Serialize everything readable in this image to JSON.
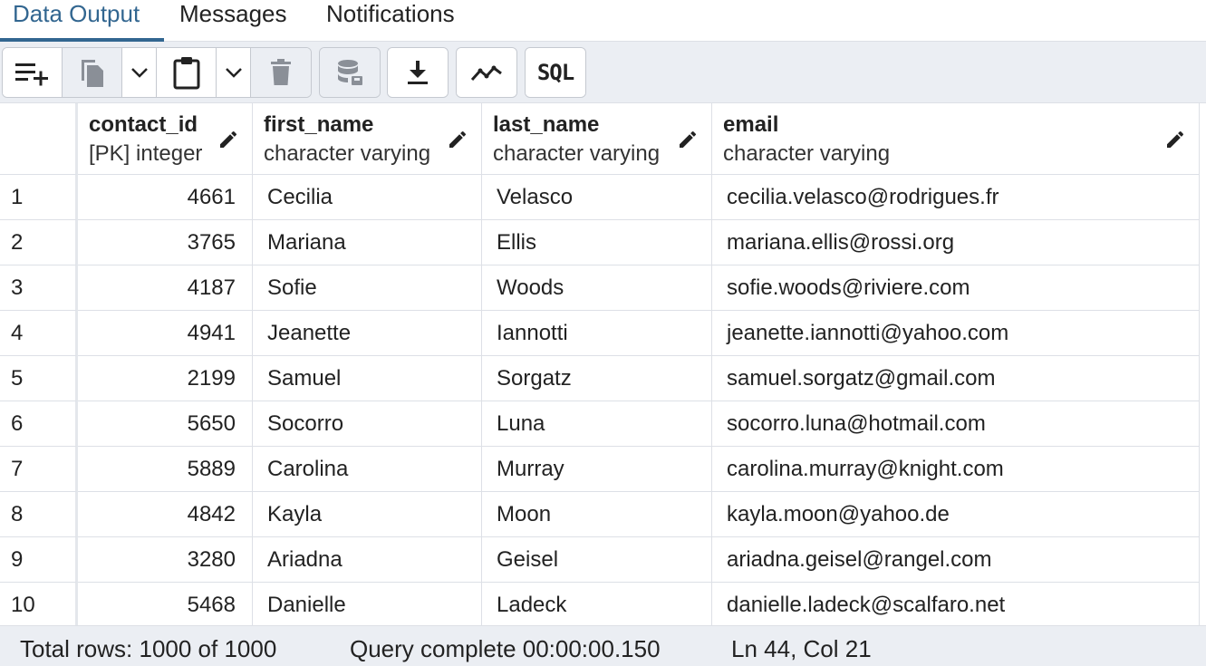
{
  "tabs": [
    {
      "label": "Data Output",
      "active": true
    },
    {
      "label": "Messages",
      "active": false
    },
    {
      "label": "Notifications",
      "active": false
    }
  ],
  "toolbar": {
    "buttons": [
      {
        "icon": "add-row-icon",
        "enabled": true
      },
      {
        "icon": "copy-icon",
        "enabled": false
      },
      {
        "icon": "chevron-down-icon",
        "enabled": true
      },
      {
        "icon": "paste-icon",
        "enabled": true
      },
      {
        "icon": "chevron-down-icon",
        "enabled": true
      },
      {
        "icon": "delete-icon",
        "enabled": false
      },
      {
        "icon": "save-data-icon",
        "enabled": false
      },
      {
        "icon": "download-icon",
        "enabled": true
      },
      {
        "icon": "graph-icon",
        "enabled": true
      },
      {
        "icon": "sql-icon",
        "enabled": true
      }
    ],
    "sql_label": "SQL"
  },
  "columns": [
    {
      "name": "contact_id",
      "type": "[PK] integer"
    },
    {
      "name": "first_name",
      "type": "character varying"
    },
    {
      "name": "last_name",
      "type": "character varying"
    },
    {
      "name": "email",
      "type": "character varying"
    }
  ],
  "rows": [
    {
      "n": "1",
      "contact_id": "4661",
      "first_name": "Cecilia",
      "last_name": "Velasco",
      "email": "cecilia.velasco@rodrigues.fr"
    },
    {
      "n": "2",
      "contact_id": "3765",
      "first_name": "Mariana",
      "last_name": "Ellis",
      "email": "mariana.ellis@rossi.org"
    },
    {
      "n": "3",
      "contact_id": "4187",
      "first_name": "Sofie",
      "last_name": "Woods",
      "email": "sofie.woods@riviere.com"
    },
    {
      "n": "4",
      "contact_id": "4941",
      "first_name": "Jeanette",
      "last_name": "Iannotti",
      "email": "jeanette.iannotti@yahoo.com"
    },
    {
      "n": "5",
      "contact_id": "2199",
      "first_name": "Samuel",
      "last_name": "Sorgatz",
      "email": "samuel.sorgatz@gmail.com"
    },
    {
      "n": "6",
      "contact_id": "5650",
      "first_name": "Socorro",
      "last_name": "Luna",
      "email": "socorro.luna@hotmail.com"
    },
    {
      "n": "7",
      "contact_id": "5889",
      "first_name": "Carolina",
      "last_name": "Murray",
      "email": "carolina.murray@knight.com"
    },
    {
      "n": "8",
      "contact_id": "4842",
      "first_name": "Kayla",
      "last_name": "Moon",
      "email": "kayla.moon@yahoo.de"
    },
    {
      "n": "9",
      "contact_id": "3280",
      "first_name": "Ariadna",
      "last_name": "Geisel",
      "email": "ariadna.geisel@rangel.com"
    },
    {
      "n": "10",
      "contact_id": "5468",
      "first_name": "Danielle",
      "last_name": "Ladeck",
      "email": "danielle.ladeck@scalfaro.net"
    }
  ],
  "status": {
    "total_rows": "Total rows: 1000 of 1000",
    "query": "Query complete 00:00:00.150",
    "cursor": "Ln 44, Col 21"
  },
  "colors": {
    "accent": "#326690",
    "toolbar_bg": "#ebeef3",
    "grid_line": "#dde0e6"
  }
}
